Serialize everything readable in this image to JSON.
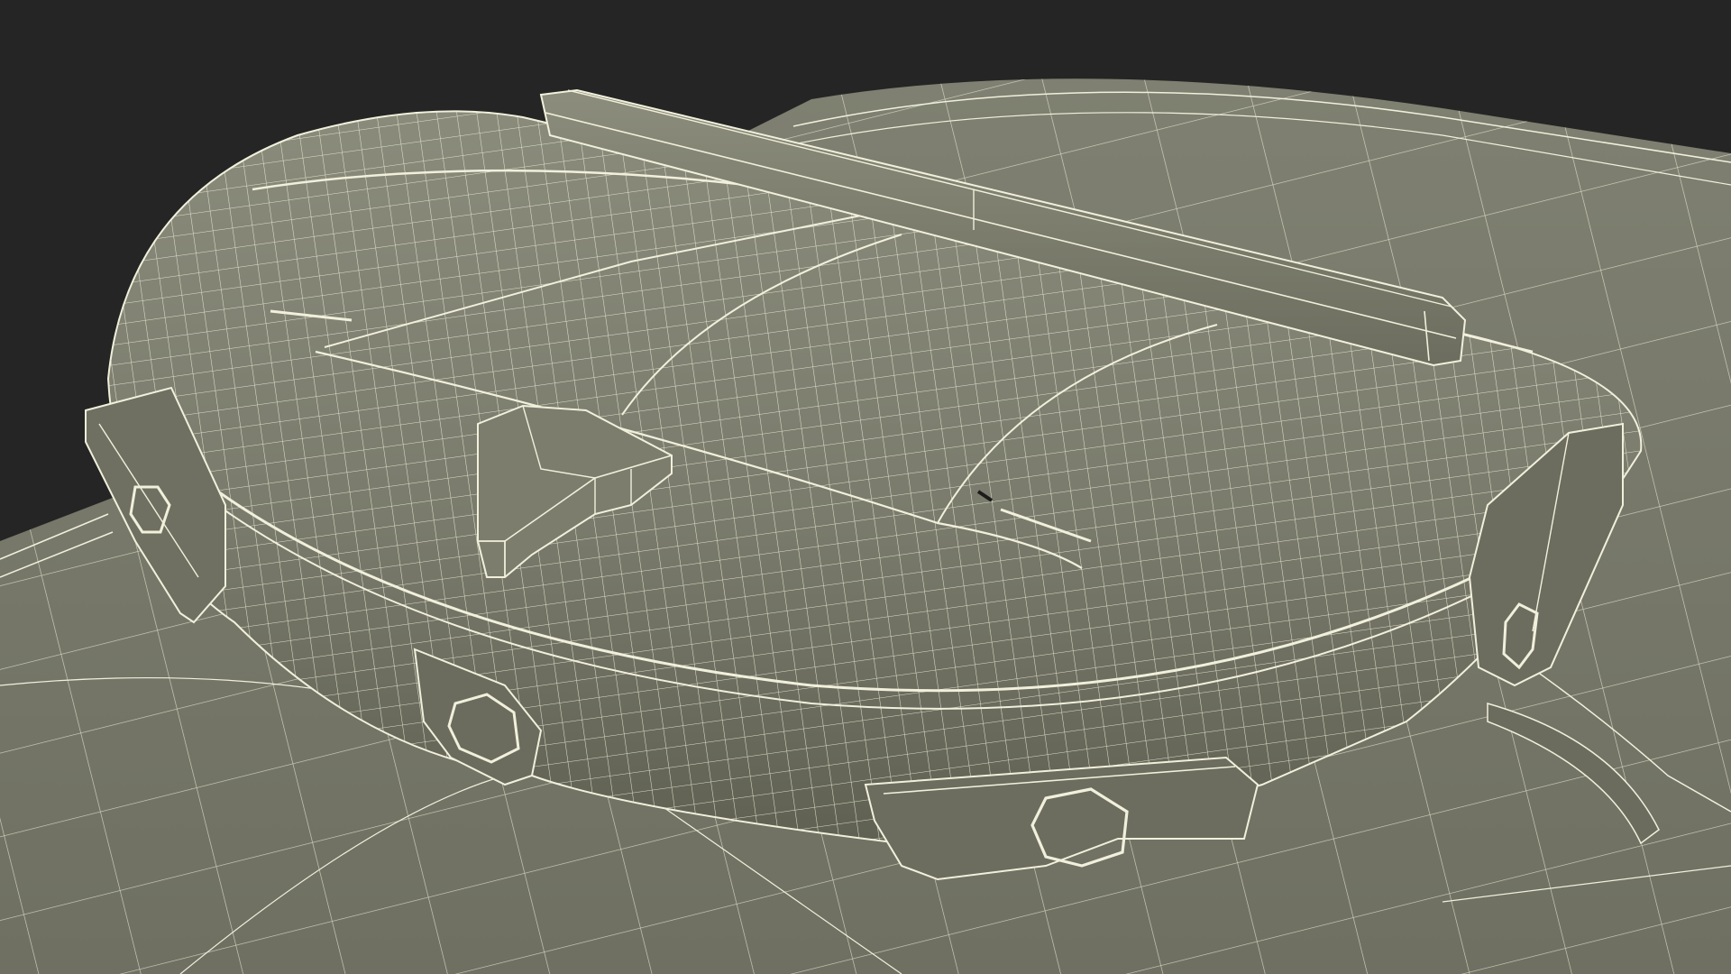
{
  "viewport": {
    "background_color": "#252525",
    "surface_color": "#7a7b6c",
    "surface_shadow_color": "#5f6052",
    "surface_highlight_color": "#8a8b7b",
    "wire_color": "#f1f0dc"
  },
  "model": {
    "subject": "wireframe-light-bar-on-roof",
    "render_mode": "wireframe-over-shaded"
  }
}
